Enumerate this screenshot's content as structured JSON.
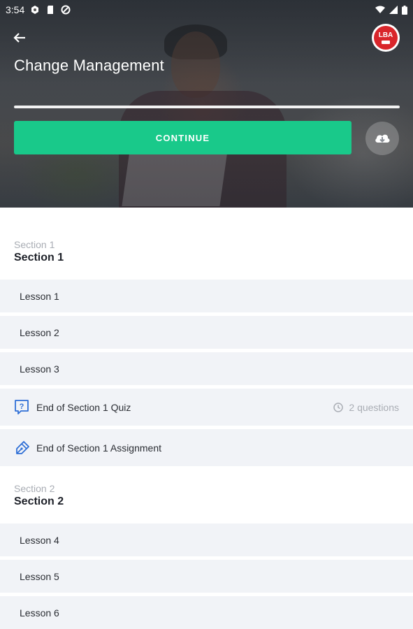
{
  "status_bar": {
    "time": "3:54"
  },
  "header": {
    "title": "Change Management",
    "logo_text": "LBA",
    "progress_fraction": 1.0,
    "continue_label": "CONTINUE"
  },
  "colors": {
    "accent": "#19c98a",
    "logo_red": "#d9262b",
    "icon_blue": "#2f6fd6"
  },
  "sections": [
    {
      "kicker": "Section 1",
      "title": "Section 1",
      "lessons": [
        "Lesson 1",
        "Lesson 2",
        "Lesson 3"
      ],
      "quiz": {
        "label": "End of Section 1 Quiz",
        "meta": "2 questions",
        "icon": "quiz-icon"
      },
      "assignment": {
        "label": "End of Section 1 Assignment",
        "icon": "assignment-pen-icon"
      }
    },
    {
      "kicker": "Section 2",
      "title": "Section 2",
      "lessons": [
        "Lesson 4",
        "Lesson 5",
        "Lesson 6"
      ]
    }
  ]
}
